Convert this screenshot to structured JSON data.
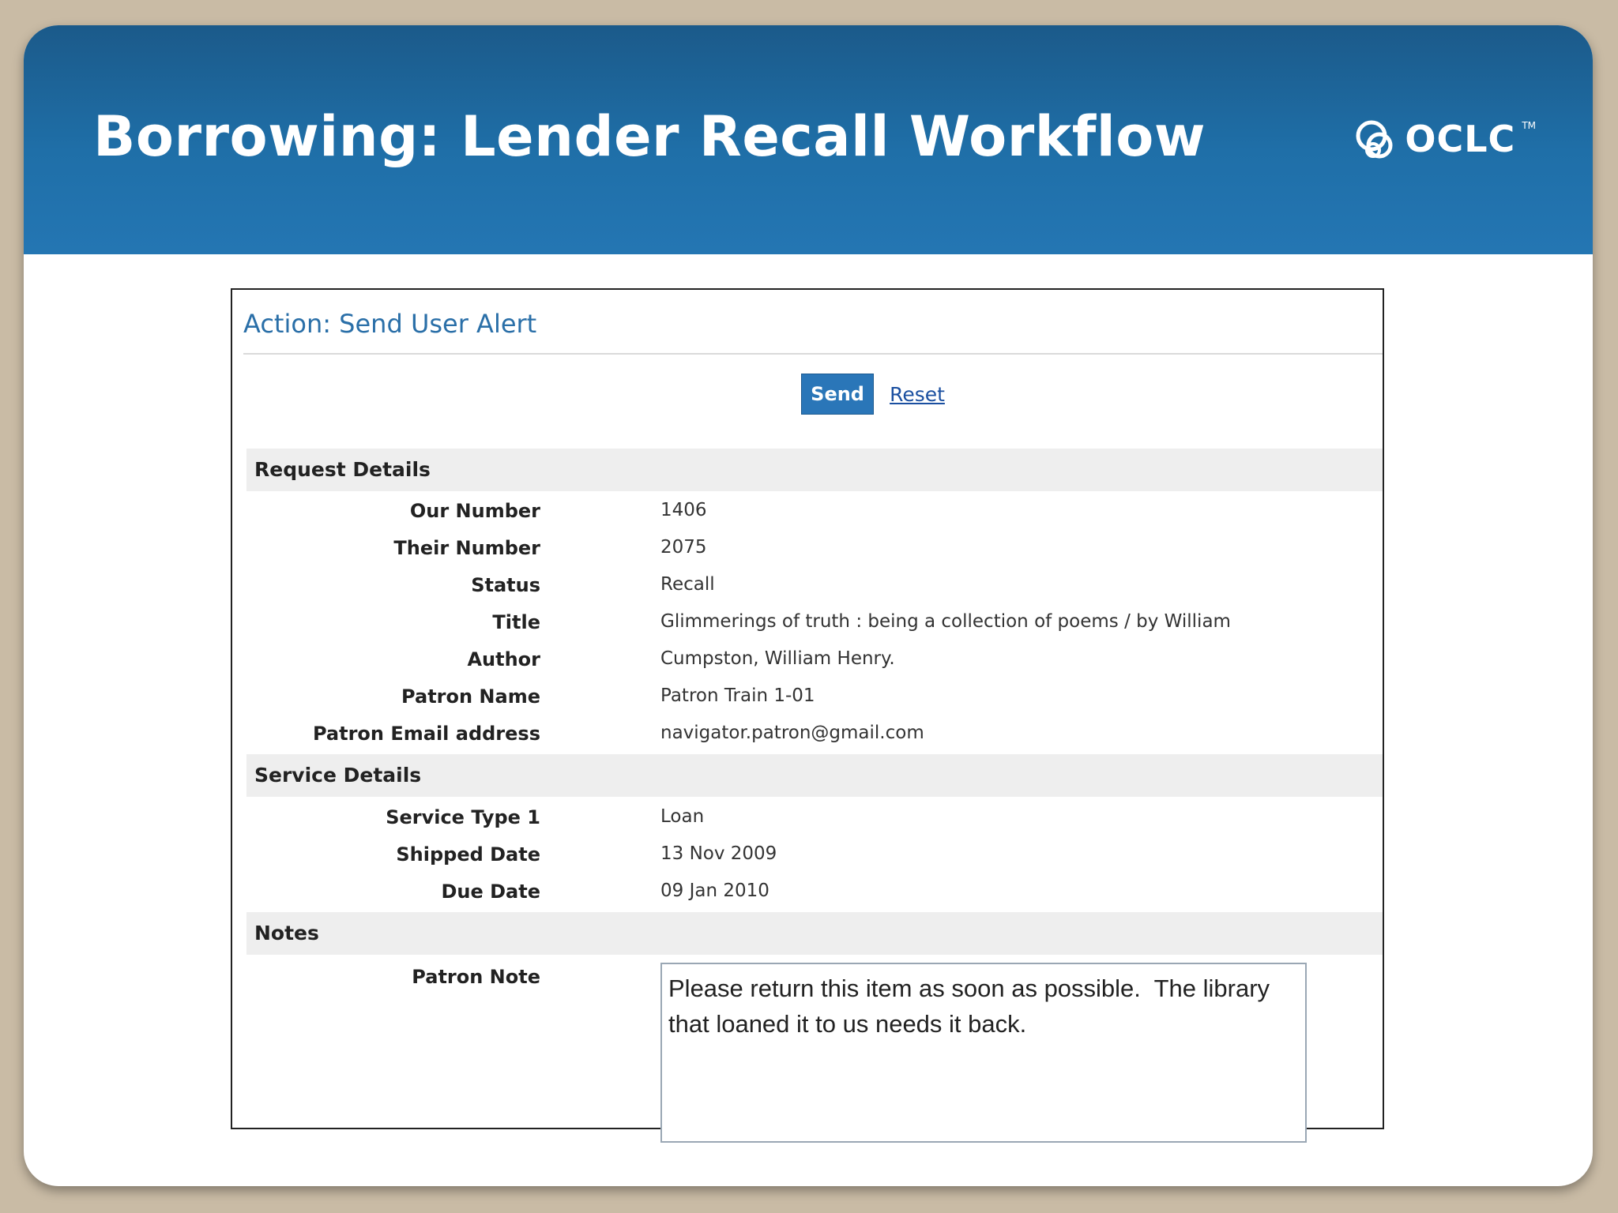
{
  "slide": {
    "title": "Borrowing: Lender Recall Workflow",
    "logo_text": "OCLC",
    "logo_tm": "TM",
    "colors": {
      "header": "#1f6fa8",
      "background": "#c9bba5"
    }
  },
  "panel": {
    "title": "Action: Send User Alert",
    "send_label": "Send",
    "reset_label": "Reset",
    "accent_color": "#2a76b8"
  },
  "request_details": {
    "heading": "Request Details",
    "rows": [
      {
        "label": "Our Number",
        "value": "1406"
      },
      {
        "label": "Their Number",
        "value": "2075"
      },
      {
        "label": "Status",
        "value": "Recall"
      },
      {
        "label": "Title",
        "value": "Glimmerings of truth : being a collection of poems / by William"
      },
      {
        "label": "Author",
        "value": "Cumpston, William Henry."
      },
      {
        "label": "Patron Name",
        "value": "Patron Train 1-01"
      },
      {
        "label": "Patron Email address",
        "value": "navigator.patron@gmail.com"
      }
    ]
  },
  "service_details": {
    "heading": "Service Details",
    "rows": [
      {
        "label": "Service Type 1",
        "value": "Loan"
      },
      {
        "label": "Shipped Date",
        "value": "13 Nov 2009"
      },
      {
        "label": "Due Date",
        "value": "09 Jan 2010"
      }
    ]
  },
  "notes": {
    "heading": "Notes",
    "patron_note_label": "Patron Note",
    "patron_note_value": "Please return this item as soon as possible.  The library that loaned it to us needs it back."
  }
}
